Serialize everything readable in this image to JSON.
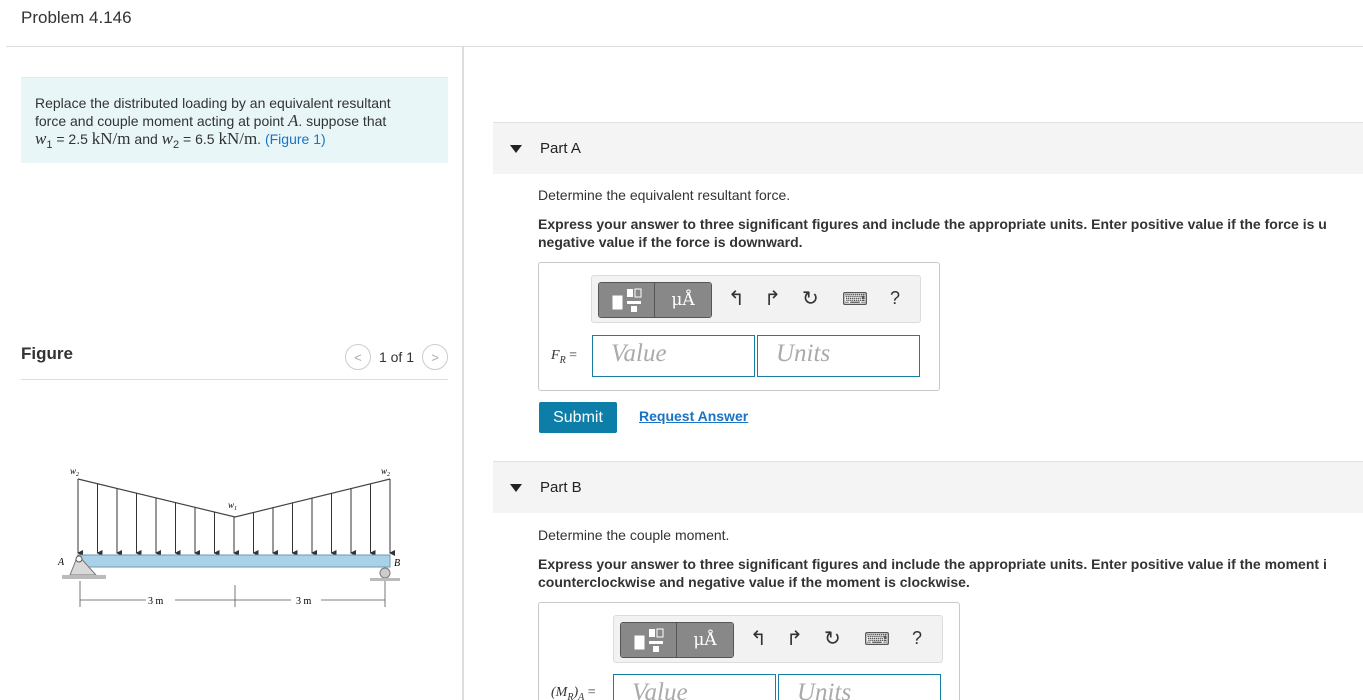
{
  "page": {
    "title": "Problem 4.146"
  },
  "problem": {
    "line1": "Replace the distributed loading by an equivalent resultant",
    "line2_pre": "force and couple moment acting at point ",
    "point": "A",
    "line2_post": ". suppose that",
    "w1_sym": "w",
    "w1_sub": "1",
    "w1_val": " = 2.5 ",
    "w1_unit": "kN/m",
    "and": " and ",
    "w2_sym": "w",
    "w2_sub": "2",
    "w2_val": " = 6.5 ",
    "w2_unit": "kN/m",
    "dot": ". ",
    "figure_link": "(Figure 1)"
  },
  "figure": {
    "label": "Figure",
    "pager_text": "1 of 1",
    "prev_glyph": "<",
    "next_glyph": ">",
    "labels": {
      "w2_left": "w",
      "w2_left_sub": "2",
      "w1_mid": "w",
      "w1_mid_sub": "1",
      "w2_right": "w",
      "w2_right_sub": "2",
      "point_a": "A",
      "point_b": "B",
      "dim_left": "3 m",
      "dim_right": "3 m"
    }
  },
  "toolbar": {
    "units_glyph": "μÅ",
    "undo_glyph": "↰",
    "redo_glyph": "↱",
    "reset_glyph": "↻",
    "keyboard_glyph": "⌨",
    "help_glyph": "?"
  },
  "partA": {
    "label": "Part A",
    "prompt": "Determine the equivalent resultant force.",
    "instr_line1": "Express your answer to three significant figures and include the appropriate units. Enter positive value if the force is u",
    "instr_line2": "negative value if the force is downward.",
    "var_sym": "F",
    "var_sub": "R",
    "var_eq": " =",
    "value_placeholder": "Value",
    "units_placeholder": "Units",
    "submit_label": "Submit",
    "request_label": "Request Answer"
  },
  "partB": {
    "label": "Part B",
    "prompt": "Determine the couple moment.",
    "instr_line1": "Express your answer to three significant figures and include the appropriate units. Enter positive value if the moment i",
    "instr_line2": "counterclockwise and negative value if the moment is clockwise.",
    "var_sym": "(M",
    "var_sub": "R",
    "var_close": ")",
    "var_sub2": "A",
    "var_eq": " =",
    "value_placeholder": "Value",
    "units_placeholder": "Units"
  }
}
